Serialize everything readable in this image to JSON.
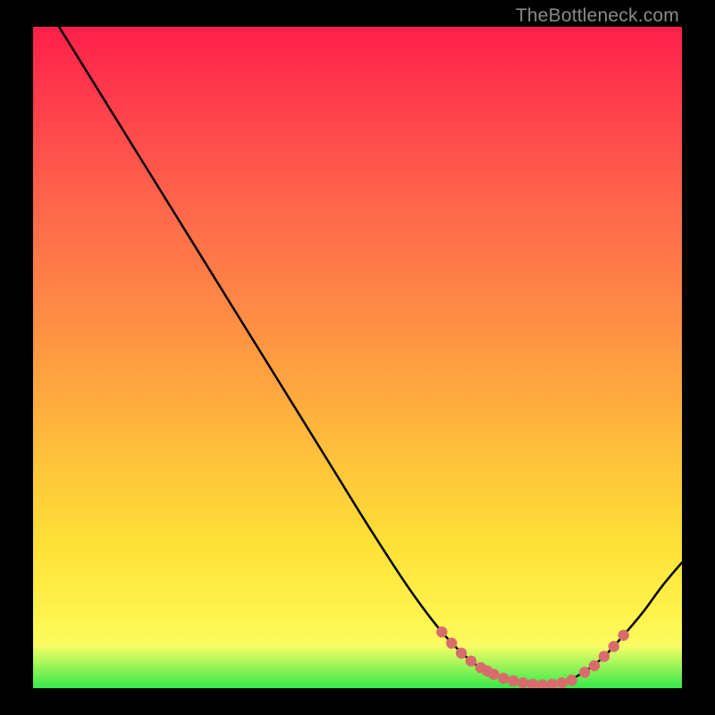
{
  "watermark": "TheBottleneck.com",
  "colors": {
    "curve_stroke": "#000000",
    "dot_fill": "#d86c6c",
    "gradient_top": "#ff1f4a",
    "gradient_bottom_yellow": "#f9ff66",
    "gradient_green": "#36e84a",
    "background": "#000000"
  },
  "chart_data": {
    "type": "line",
    "title": "",
    "xlabel": "",
    "ylabel": "",
    "xlim": [
      0,
      100
    ],
    "ylim": [
      0,
      100
    ],
    "curve": [
      {
        "x": 4.0,
        "y": 100.0
      },
      {
        "x": 10.0,
        "y": 90.5
      },
      {
        "x": 16.0,
        "y": 81.0
      },
      {
        "x": 22.0,
        "y": 71.5
      },
      {
        "x": 28.0,
        "y": 62.0
      },
      {
        "x": 34.0,
        "y": 52.5
      },
      {
        "x": 40.0,
        "y": 43.0
      },
      {
        "x": 46.0,
        "y": 33.5
      },
      {
        "x": 52.0,
        "y": 24.0
      },
      {
        "x": 58.0,
        "y": 15.0
      },
      {
        "x": 63.0,
        "y": 8.5
      },
      {
        "x": 67.0,
        "y": 4.5
      },
      {
        "x": 70.0,
        "y": 2.5
      },
      {
        "x": 73.0,
        "y": 1.3
      },
      {
        "x": 76.0,
        "y": 0.7
      },
      {
        "x": 79.0,
        "y": 0.5
      },
      {
        "x": 82.0,
        "y": 1.0
      },
      {
        "x": 85.0,
        "y": 2.5
      },
      {
        "x": 88.0,
        "y": 4.8
      },
      {
        "x": 91.0,
        "y": 8.0
      },
      {
        "x": 94.0,
        "y": 11.5
      },
      {
        "x": 97.0,
        "y": 15.5
      },
      {
        "x": 100.0,
        "y": 19.0
      }
    ],
    "dots": [
      {
        "x": 63.0,
        "y": 8.5
      },
      {
        "x": 64.5,
        "y": 6.8
      },
      {
        "x": 66.0,
        "y": 5.3
      },
      {
        "x": 67.5,
        "y": 4.1
      },
      {
        "x": 69.0,
        "y": 3.1
      },
      {
        "x": 70.0,
        "y": 2.6
      },
      {
        "x": 71.0,
        "y": 2.1
      },
      {
        "x": 72.5,
        "y": 1.5
      },
      {
        "x": 74.0,
        "y": 1.1
      },
      {
        "x": 75.5,
        "y": 0.8
      },
      {
        "x": 77.0,
        "y": 0.6
      },
      {
        "x": 78.5,
        "y": 0.5
      },
      {
        "x": 80.0,
        "y": 0.6
      },
      {
        "x": 81.5,
        "y": 0.8
      },
      {
        "x": 83.0,
        "y": 1.2
      },
      {
        "x": 85.0,
        "y": 2.4
      },
      {
        "x": 86.5,
        "y": 3.4
      },
      {
        "x": 88.0,
        "y": 4.8
      },
      {
        "x": 89.5,
        "y": 6.3
      },
      {
        "x": 91.0,
        "y": 8.0
      }
    ]
  }
}
